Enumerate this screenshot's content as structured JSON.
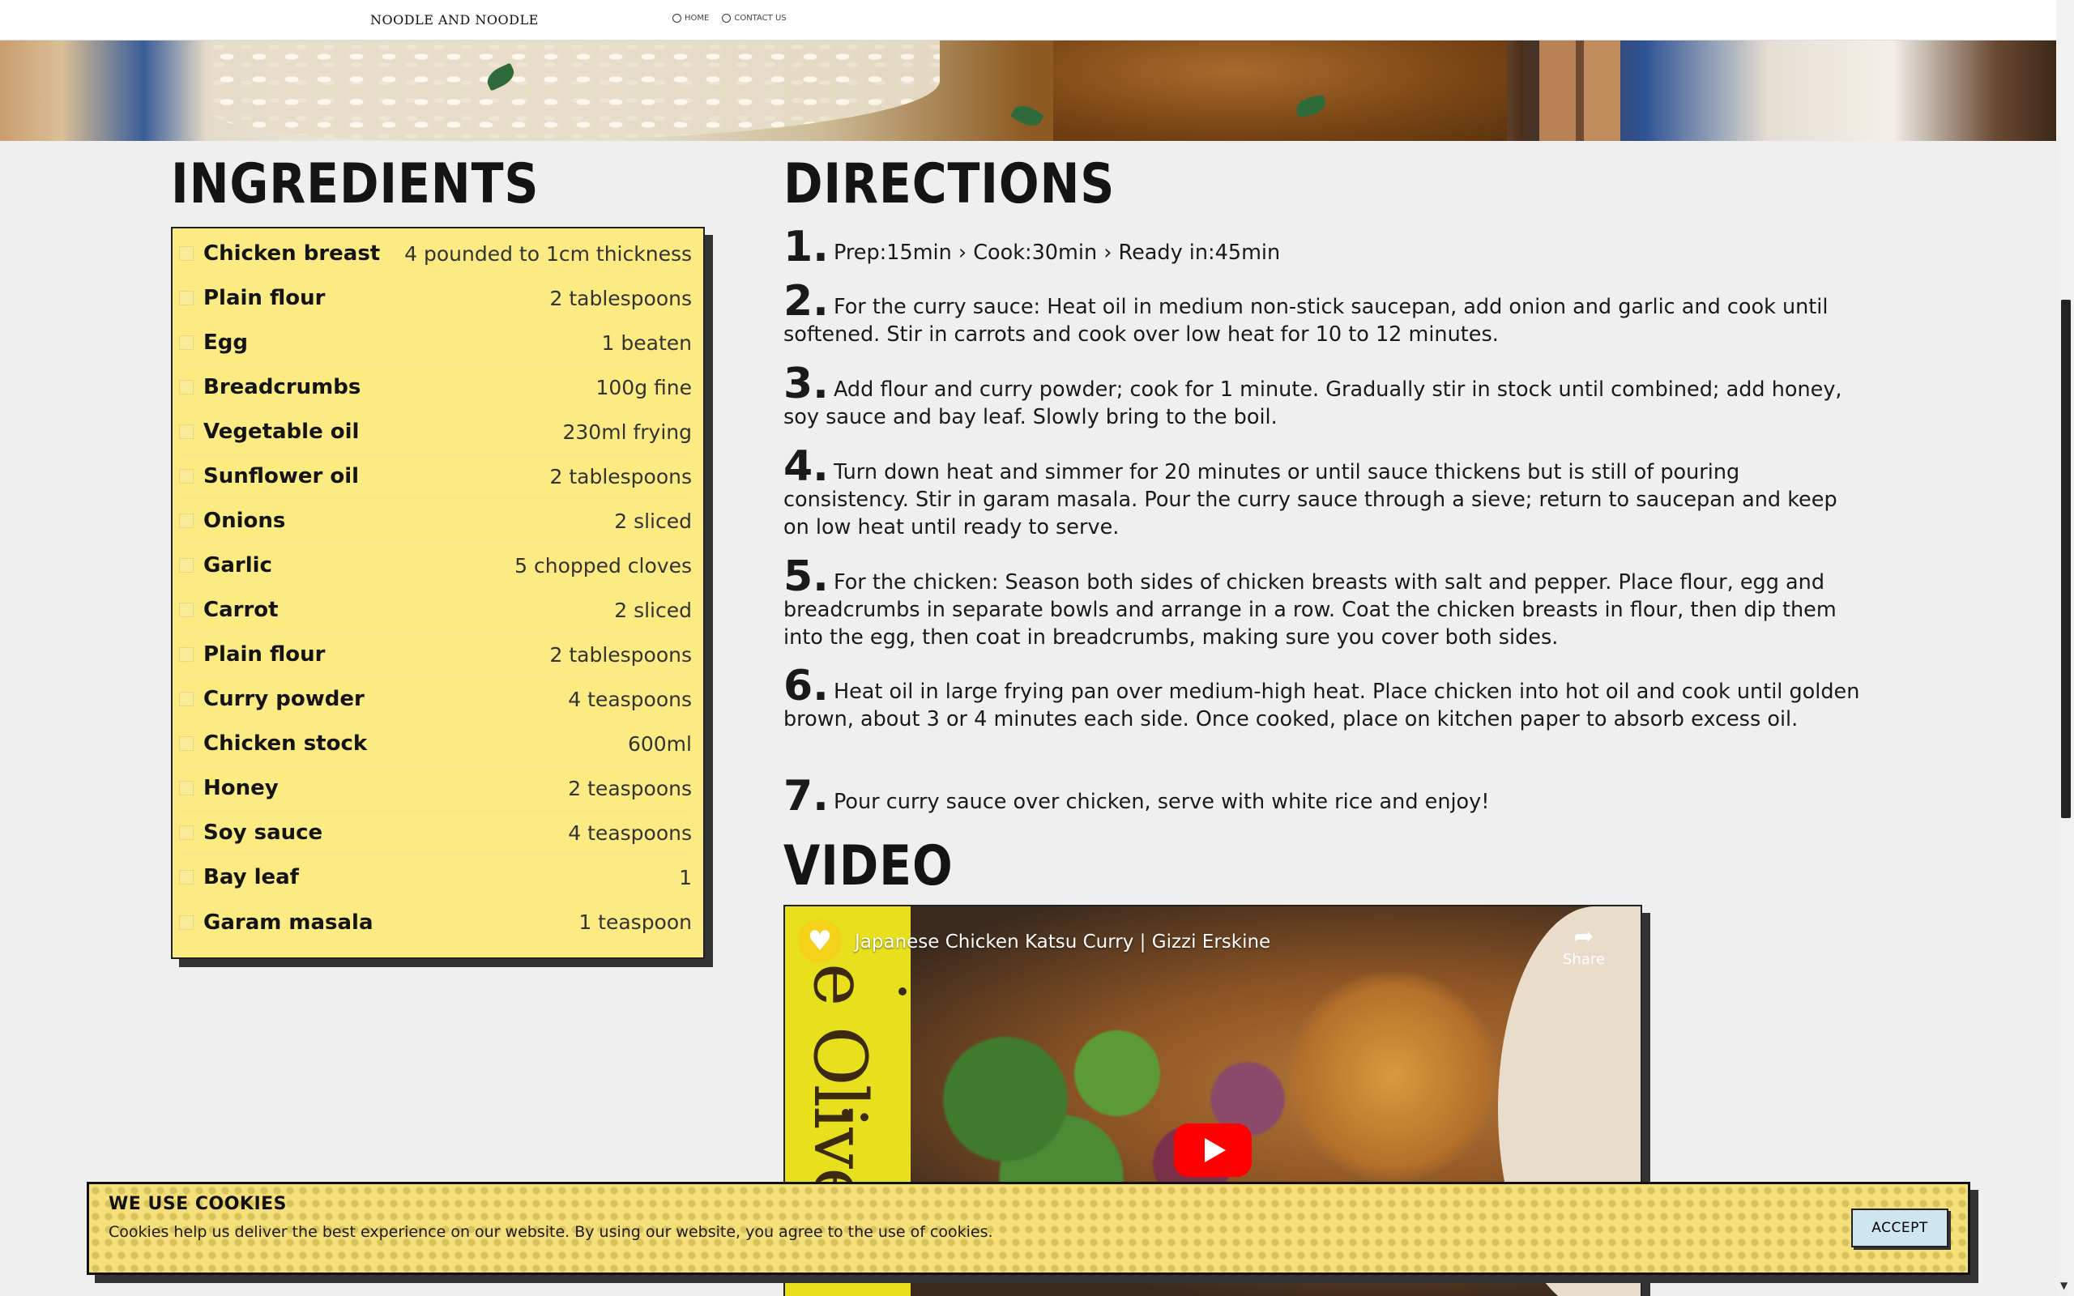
{
  "nav": {
    "brand": "NOODLE AND NOODLE",
    "links": [
      {
        "label": "HOME"
      },
      {
        "label": "CONTACT US"
      }
    ]
  },
  "ingredients": {
    "heading": "INGREDIENTS",
    "items": [
      {
        "name": "Chicken breast",
        "qty": "4 pounded to 1cm thickness"
      },
      {
        "name": "Plain flour",
        "qty": "2 tablespoons"
      },
      {
        "name": "Egg",
        "qty": "1 beaten"
      },
      {
        "name": "Breadcrumbs",
        "qty": "100g fine"
      },
      {
        "name": "Vegetable oil",
        "qty": "230ml frying"
      },
      {
        "name": "Sunflower oil",
        "qty": "2 tablespoons"
      },
      {
        "name": "Onions",
        "qty": "2 sliced"
      },
      {
        "name": "Garlic",
        "qty": "5 chopped cloves"
      },
      {
        "name": "Carrot",
        "qty": "2 sliced"
      },
      {
        "name": "Plain flour",
        "qty": "2 tablespoons"
      },
      {
        "name": "Curry powder",
        "qty": "4 teaspoons"
      },
      {
        "name": "Chicken stock",
        "qty": "600ml"
      },
      {
        "name": "Honey",
        "qty": "2 teaspoons"
      },
      {
        "name": "Soy sauce",
        "qty": "4 teaspoons"
      },
      {
        "name": "Bay leaf",
        "qty": "1"
      },
      {
        "name": "Garam masala",
        "qty": "1 teaspoon"
      }
    ]
  },
  "directions": {
    "heading": "DIRECTIONS",
    "steps": [
      {
        "num": "1.",
        "text": "Prep:15min › Cook:30min › Ready in:45min"
      },
      {
        "num": "2.",
        "text": "For the curry sauce: Heat oil in medium non-stick saucepan, add onion and garlic and cook until softened. Stir in carrots and cook over low heat for 10 to 12 minutes."
      },
      {
        "num": "3.",
        "text": "Add flour and curry powder; cook for 1 minute. Gradually stir in stock until combined; add honey, soy sauce and bay leaf. Slowly bring to the boil."
      },
      {
        "num": "4.",
        "text": "Turn down heat and simmer for 20 minutes or until sauce thickens but is still of pouring consistency. Stir in garam masala. Pour the curry sauce through a sieve; return to saucepan and keep on low heat until ready to serve."
      },
      {
        "num": "5.",
        "text": "For the chicken: Season both sides of chicken breasts with salt and pepper. Place flour, egg and breadcrumbs in separate bowls and arrange in a row. Coat the chicken breasts in flour, then dip them into the egg, then coat in breadcrumbs, making sure you cover both sides."
      },
      {
        "num": "6.",
        "text": "Heat oil in large frying pan over medium-high heat. Place chicken into hot oil and cook until golden brown, about 3 or 4 minutes each side. Once cooked, place on kitchen paper to absorb excess oil."
      },
      {
        "num": "7.",
        "text": "Pour curry sauce over chicken, serve with white rice and enjoy!"
      }
    ]
  },
  "video": {
    "heading": "VIDEO",
    "title": "Japanese Chicken Katsu Curry | Gizzi Erskine",
    "share_label": "Share",
    "brand_text": "e Oliver"
  },
  "cookies": {
    "title": "WE USE COOKIES",
    "text": "Cookies help us deliver the best experience on our website. By using our website, you agree to the use of cookies.",
    "accept_label": "ACCEPT"
  },
  "colors": {
    "card_yellow": "#fbeb82",
    "page_bg": "#efefef",
    "accept_bg": "#cde6ef",
    "play_red": "#ff0000"
  }
}
